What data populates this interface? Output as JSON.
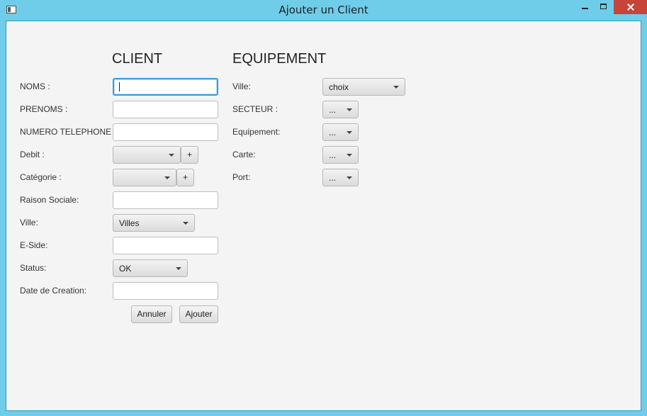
{
  "window": {
    "title": "Ajouter un Client"
  },
  "client": {
    "heading": "CLIENT",
    "labels": {
      "noms": "NOMS :",
      "prenoms": "PRENOMS :",
      "telephone": "NUMERO TELEPHONE :",
      "debit": "Debit :",
      "categorie": "Catégorie :",
      "raison": "Raison Sociale:",
      "ville": "Ville:",
      "eside": "E-Side:",
      "status": "Status:",
      "date": "Date de Creation:"
    },
    "values": {
      "noms": "",
      "prenoms": "",
      "telephone": "",
      "raison": "",
      "eside": "",
      "date": "",
      "debit": "",
      "categorie": "",
      "ville": "Villes",
      "status": "OK"
    },
    "add_label": "+",
    "annuler": "Annuler",
    "ajouter": "Ajouter"
  },
  "equipement": {
    "heading": "EQUIPEMENT",
    "labels": {
      "ville": "Ville:",
      "secteur": "SECTEUR :",
      "equipement": "Equipement:",
      "carte": "Carte:",
      "port": "Port:"
    },
    "values": {
      "ville": "choix",
      "secteur": "...",
      "equipement": "...",
      "carte": "...",
      "port": "..."
    }
  }
}
